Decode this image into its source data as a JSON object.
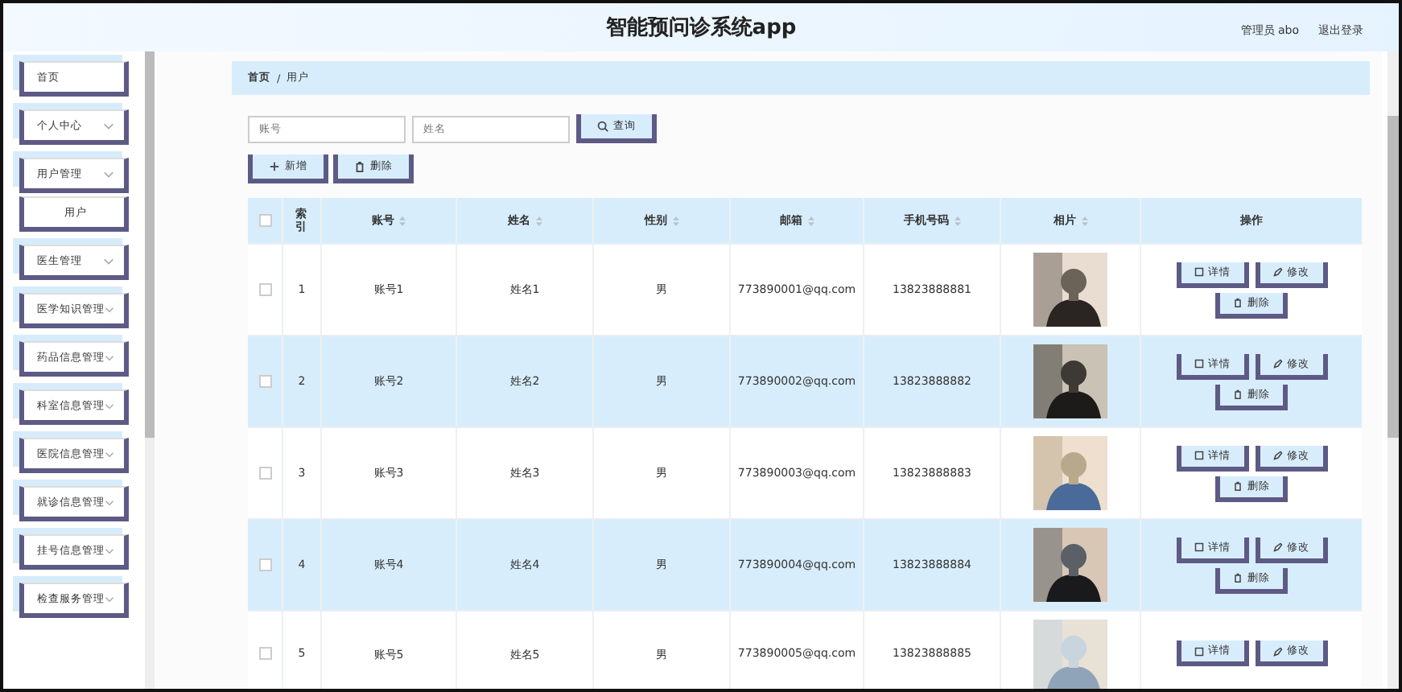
{
  "header": {
    "title": "智能预问诊系统app",
    "user": "管理员 abo",
    "logout": "退出登录"
  },
  "sidebar": {
    "items": [
      {
        "label": "首页",
        "has_arrow": false
      },
      {
        "label": "个人中心",
        "has_arrow": true
      },
      {
        "label": "用户管理",
        "has_arrow": true,
        "children": [
          {
            "label": "用户"
          }
        ]
      },
      {
        "label": "医生管理",
        "has_arrow": true
      },
      {
        "label": "医学知识管理",
        "has_arrow": true
      },
      {
        "label": "药品信息管理",
        "has_arrow": true
      },
      {
        "label": "科室信息管理",
        "has_arrow": true
      },
      {
        "label": "医院信息管理",
        "has_arrow": true
      },
      {
        "label": "就诊信息管理",
        "has_arrow": true
      },
      {
        "label": "挂号信息管理",
        "has_arrow": true
      },
      {
        "label": "检查服务管理",
        "has_arrow": true
      }
    ]
  },
  "breadcrumb": {
    "items": [
      "首页",
      "用户"
    ],
    "separator": "/"
  },
  "search": {
    "fields": [
      {
        "placeholder": "账号"
      },
      {
        "placeholder": "姓名"
      }
    ],
    "button": "查询"
  },
  "actions": [
    "新增",
    "删除"
  ],
  "table": {
    "select_all_checked": false,
    "columns": [
      {
        "label": "索引",
        "sortable": false
      },
      {
        "label": "账号",
        "sortable": true
      },
      {
        "label": "姓名",
        "sortable": true
      },
      {
        "label": "性别",
        "sortable": true
      },
      {
        "label": "邮箱",
        "sortable": true
      },
      {
        "label": "手机号码",
        "sortable": true
      },
      {
        "label": "相片",
        "sortable": true
      },
      {
        "label": "操作",
        "sortable": false
      }
    ],
    "rows": [
      {
        "checked": false,
        "index": "1",
        "account": "账号1",
        "name": "姓名1",
        "gender": "男",
        "email": "773890001@qq.com",
        "phone": "13823888881",
        "photo": {
          "kind": "picture"
        },
        "buttons": [
          "详情",
          "修改",
          "删除"
        ]
      },
      {
        "checked": false,
        "index": "2",
        "account": "账号2",
        "name": "姓名2",
        "gender": "男",
        "email": "773890002@qq.com",
        "phone": "13823888882",
        "photo": {
          "kind": "picture"
        },
        "buttons": [
          "详情",
          "修改",
          "删除"
        ]
      },
      {
        "checked": false,
        "index": "3",
        "account": "账号3",
        "name": "姓名3",
        "gender": "男",
        "email": "773890003@qq.com",
        "phone": "13823888883",
        "photo": {
          "kind": "picture"
        },
        "buttons": [
          "详情",
          "修改",
          "删除"
        ]
      },
      {
        "checked": false,
        "index": "4",
        "account": "账号4",
        "name": "姓名4",
        "gender": "男",
        "email": "773890004@qq.com",
        "phone": "13823888884",
        "photo": {
          "kind": "picture"
        },
        "buttons": [
          "详情",
          "修改",
          "删除"
        ]
      },
      {
        "checked": false,
        "index": "5",
        "account": "账号5",
        "name": "姓名5",
        "gender": "男",
        "email": "773890005@qq.com",
        "phone": "13823888885",
        "photo": {
          "kind": "picture"
        },
        "buttons": [
          "详情",
          "修改"
        ]
      }
    ]
  }
}
